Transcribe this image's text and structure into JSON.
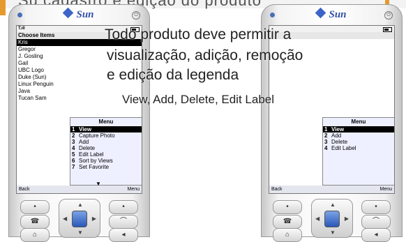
{
  "slide_title_fragment": "Su cadastro e edição do produto",
  "phone_left": {
    "brand": "Sun",
    "status_signal": "T.ıll",
    "screen_title": "Choose Items",
    "items": [
      "Kris",
      "Gregor",
      "J. Gosling",
      "Gail",
      "UBC Logo",
      "Duke (Sun)",
      "Linux Penguin",
      "Java",
      "Tucan Sam"
    ],
    "menu_title": "Menu",
    "menu_items": [
      {
        "num": "1",
        "label": "View"
      },
      {
        "num": "2",
        "label": "Capture Photo"
      },
      {
        "num": "3",
        "label": "Add"
      },
      {
        "num": "4",
        "label": "Delete"
      },
      {
        "num": "5",
        "label": "Edit Label"
      },
      {
        "num": "6",
        "label": "Sort by Views"
      },
      {
        "num": "7",
        "label": "Set Favorite"
      }
    ],
    "soft_left": "Back",
    "soft_right": "Menu"
  },
  "phone_right": {
    "brand": "Sun",
    "menu_title": "Menu",
    "menu_items": [
      {
        "num": "1",
        "label": "View"
      },
      {
        "num": "2",
        "label": "Add"
      },
      {
        "num": "3",
        "label": "Delete"
      },
      {
        "num": "4",
        "label": "Edit Label"
      }
    ],
    "soft_left": "Back",
    "soft_right": "Menu"
  },
  "overlay": {
    "line1": "Todo produto deve permitir a",
    "line2": "visualização, adição, remoção",
    "line3": "e edição da legenda",
    "english": "View, Add, Delete, Edit Label"
  },
  "colors": {
    "accent_orange": "#e69a2e",
    "sun_blue": "#3350a8",
    "menu_bg": "#eef0ff"
  }
}
